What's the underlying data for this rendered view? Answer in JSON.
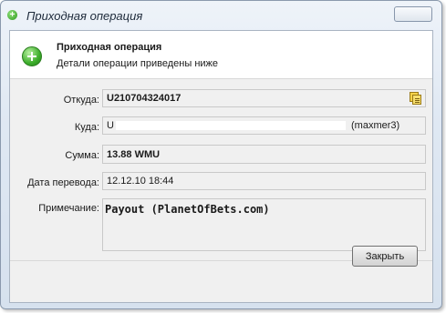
{
  "window": {
    "title": "Приходная операция"
  },
  "header": {
    "title": "Приходная операция",
    "subtitle": "Детали операции приведены ниже"
  },
  "fields": {
    "from": {
      "label": "Откуда:",
      "value": "U210704324017"
    },
    "to": {
      "label": "Куда:",
      "prefix": "U",
      "suffix": "(maxmer3)"
    },
    "amount": {
      "label": "Сумма:",
      "value": "13.88 WMU"
    },
    "date": {
      "label": "Дата перевода:",
      "value": "12.12.10 18:44"
    },
    "note": {
      "label": "Примечание:",
      "value": "Payout (PlanetOfBets.com)"
    }
  },
  "buttons": {
    "close_label": "Закрыть"
  },
  "icons": {
    "title": "plus-circle-icon",
    "header": "plus-circle-icon",
    "copy": "copy-icon",
    "close": "close-icon"
  },
  "colors": {
    "accent_green": "#3cad2a",
    "window_frame": "#dfe8f3"
  }
}
